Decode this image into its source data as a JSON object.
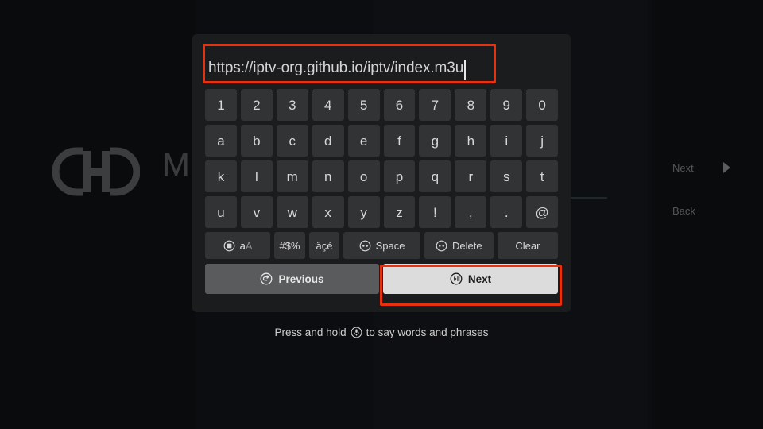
{
  "background": {
    "app_title": "M",
    "link_icon": "link-icon",
    "nav": {
      "next_label": "Next",
      "back_label": "Back",
      "arrow_icon": "play-arrow-icon"
    }
  },
  "dialog": {
    "text_field": {
      "value": "https://iptv-org.github.io/iptv/index.m3u",
      "placeholder": "",
      "caret_visible": true
    },
    "keyboard": {
      "rows": [
        [
          "1",
          "2",
          "3",
          "4",
          "5",
          "6",
          "7",
          "8",
          "9",
          "0"
        ],
        [
          "a",
          "b",
          "c",
          "d",
          "e",
          "f",
          "g",
          "h",
          "i",
          "j"
        ],
        [
          "k",
          "l",
          "m",
          "n",
          "o",
          "p",
          "q",
          "r",
          "s",
          "t"
        ],
        [
          "u",
          "v",
          "w",
          "x",
          "y",
          "z",
          "!",
          ",",
          ".",
          "@"
        ]
      ],
      "function_row": {
        "shift_icon": "remote-square-button-icon",
        "shift_lower": "a",
        "shift_upper": "A",
        "symbols_label": "#$%",
        "accents_label": "äçé",
        "space_icon": "remote-dpad-button-icon",
        "space_label": "Space",
        "delete_icon": "remote-dpad-button-icon",
        "delete_label": "Delete",
        "clear_label": "Clear"
      },
      "actions": {
        "previous_icon": "remote-back-button-icon",
        "previous_label": "Previous",
        "next_icon": "remote-playpause-button-icon",
        "next_label": "Next"
      }
    }
  },
  "hint": {
    "prefix": "Press and hold",
    "mic_icon": "microphone-button-icon",
    "suffix": "to say words and phrases"
  },
  "annotations": {
    "color": "#e8310e",
    "targets": [
      "url-text-field",
      "next-button"
    ]
  }
}
